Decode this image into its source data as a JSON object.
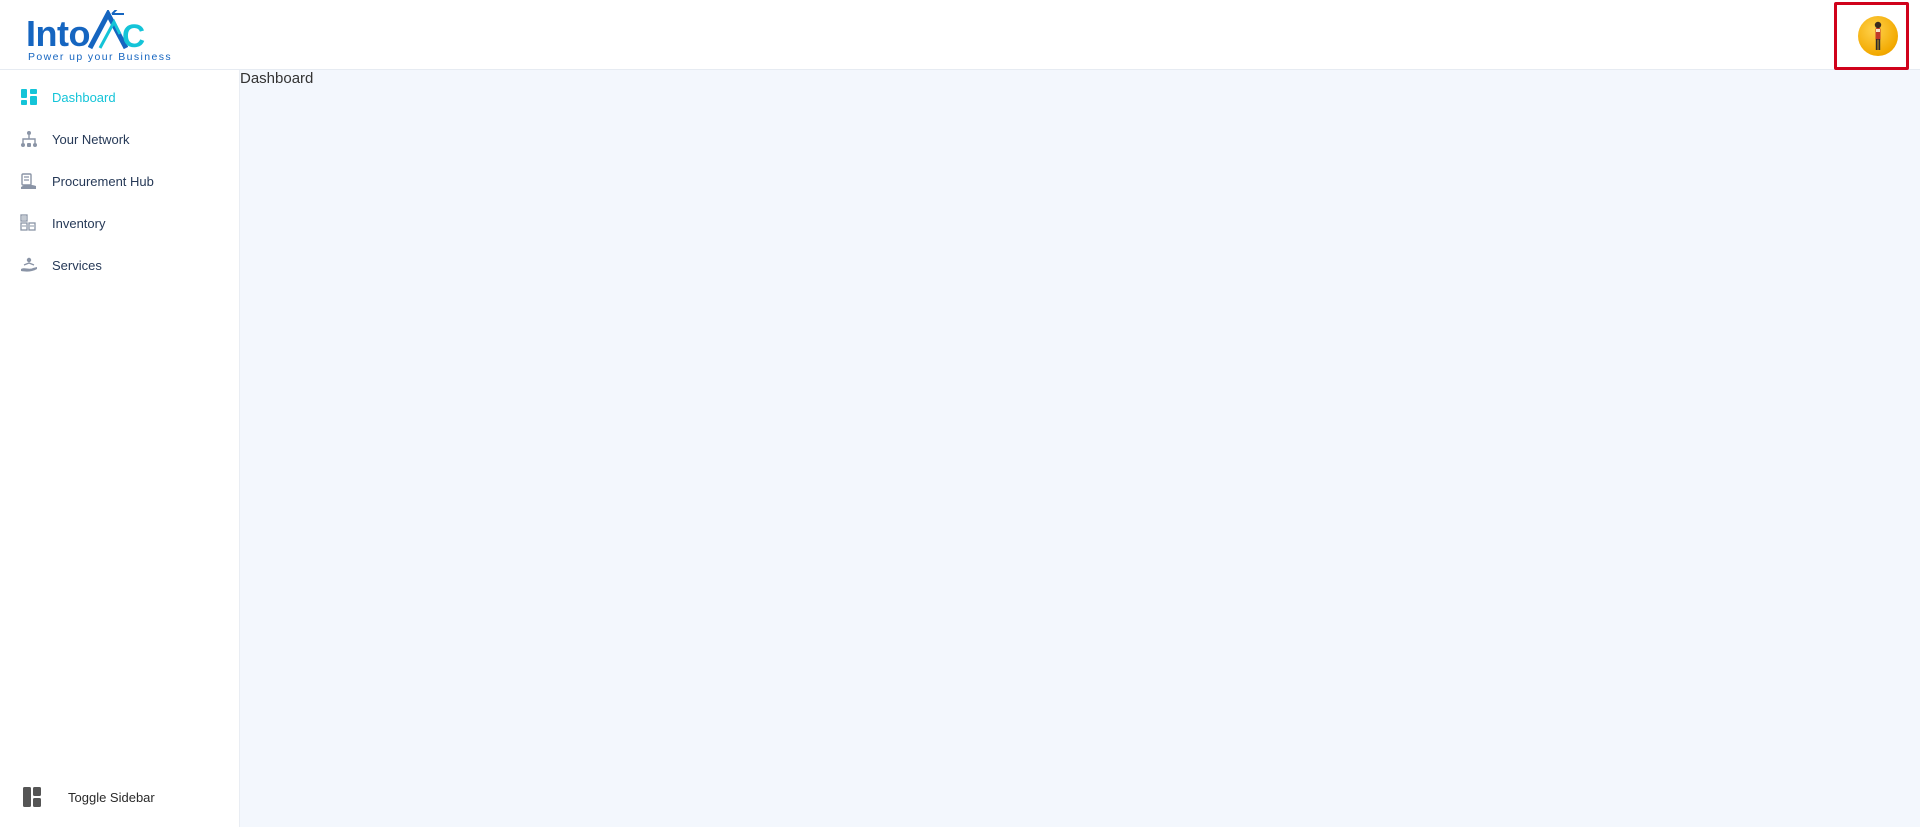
{
  "header": {
    "logo": {
      "name": "IntoAEC",
      "tagline": "Power up your Business"
    },
    "avatar_icon": "user-avatar"
  },
  "sidebar": {
    "items": [
      {
        "label": "Dashboard",
        "icon": "dashboard-icon",
        "active": true
      },
      {
        "label": "Your Network",
        "icon": "network-icon",
        "active": false
      },
      {
        "label": "Procurement Hub",
        "icon": "procurement-icon",
        "active": false
      },
      {
        "label": "Inventory",
        "icon": "inventory-icon",
        "active": false
      },
      {
        "label": "Services",
        "icon": "services-icon",
        "active": false
      }
    ],
    "toggle_label": "Toggle Sidebar"
  },
  "main": {
    "title": "Dashboard"
  },
  "colors": {
    "accent": "#14c4d8",
    "brand": "#1565c0",
    "highlight": "#d0021b",
    "content_bg": "#f3f7fd"
  }
}
